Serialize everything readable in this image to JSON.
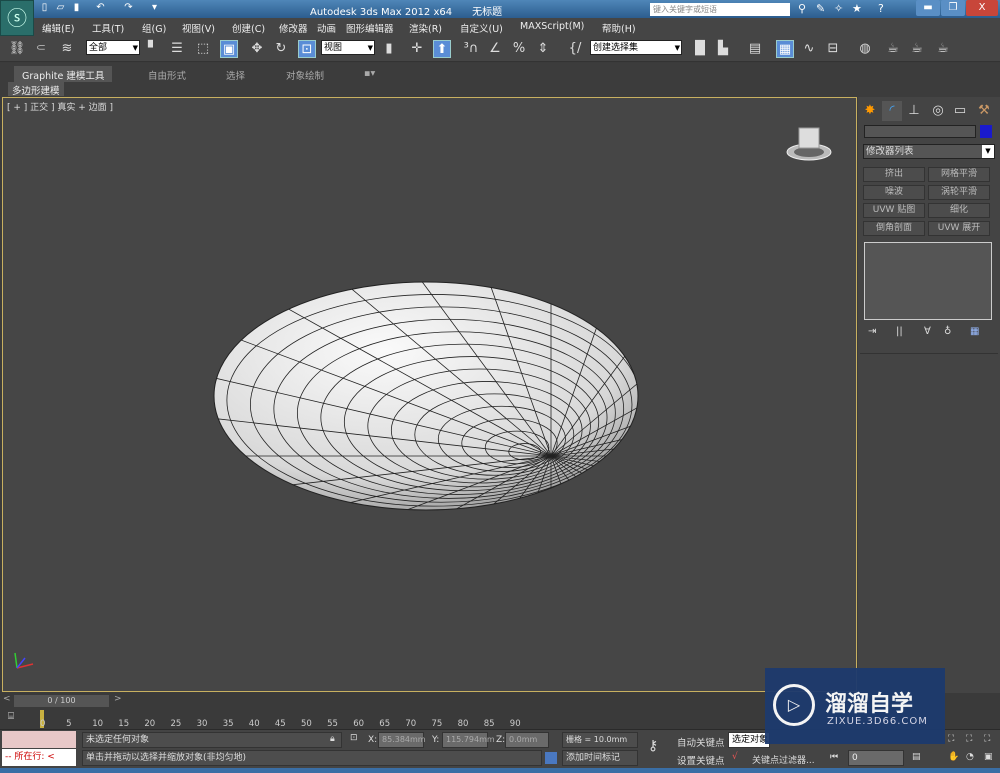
{
  "app": {
    "title": "Autodesk 3ds Max  2012 x64",
    "doc": "无标题",
    "search_placeholder": "键入关键字或短语"
  },
  "menu": [
    "编辑(E)",
    "工具(T)",
    "组(G)",
    "视图(V)",
    "创建(C)",
    "修改器",
    "动画",
    "图形编辑器",
    "渲染(R)",
    "自定义(U)",
    "MAXScript(M)",
    "帮助(H)"
  ],
  "toolbar": {
    "selection_filter": "全部",
    "ref_coord": "视图",
    "named_selection": "创建选择集"
  },
  "ribbon": {
    "tabs": [
      "Graphite 建模工具",
      "自由形式",
      "选择",
      "对象绘制"
    ],
    "active_sub": "多边形建模"
  },
  "viewport": {
    "label": "[ + ] 正交 ] 真实 + 边面 ]"
  },
  "panel": {
    "modifier_list": "修改器列表",
    "color": "#1a1acc",
    "buttons": [
      "挤出",
      "网格平滑",
      "噪波",
      "涡轮平滑",
      "UVW 贴图",
      "细化",
      "倒角剖面",
      "UVW 展开"
    ]
  },
  "timeline": {
    "frame": "0 / 100",
    "ticks": [
      "0",
      "5",
      "10",
      "15",
      "20",
      "25",
      "30",
      "35",
      "40",
      "45",
      "50",
      "55",
      "60",
      "65",
      "70",
      "75",
      "80",
      "85",
      "90"
    ]
  },
  "status": {
    "selection": "未选定任何对象",
    "prompt": "单击并拖动以选择并缩放对象(非均匀地)",
    "maxscript": "-- 所在行: <",
    "x_label": "X:",
    "x": "85.384mm",
    "y_label": "Y:",
    "y": "115.794mm",
    "z_label": "Z:",
    "z": "0.0mm",
    "grid": "栅格 = 10.0mm",
    "add_tag": "添加时间标记",
    "auto_key": "自动关键点",
    "set_key": "设置关键点",
    "selected": "选定对象",
    "key_filter": "关键点过滤器...",
    "frame_field": "0"
  },
  "watermark": {
    "brand": "溜溜自学",
    "url": "ZIXUE.3D66.COM"
  }
}
